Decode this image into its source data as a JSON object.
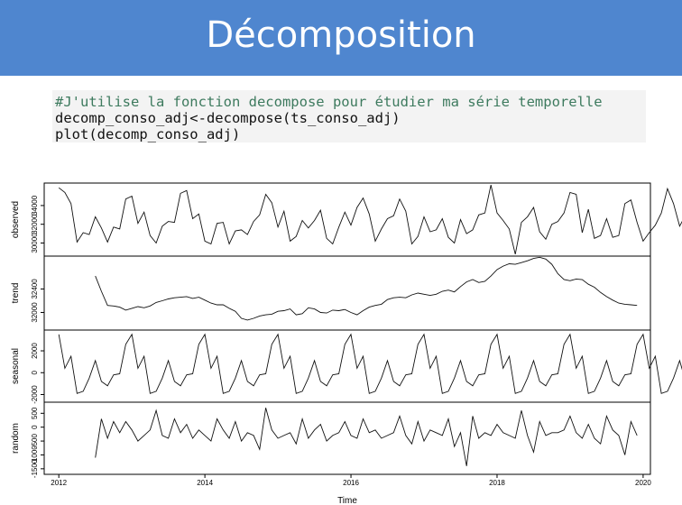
{
  "header": {
    "title": "Décomposition"
  },
  "code": {
    "lines": [
      "#J'utilise la fonction decompose pour étudier ma série temporelle",
      "decomp_conso_adj<-decompose(ts_conso_adj)",
      "plot(decomp_conso_adj)"
    ]
  },
  "chart_data": {
    "type": "line",
    "x_axis": {
      "ticks": [
        "2012",
        "2014",
        "2016",
        "2018",
        "2020"
      ],
      "range": [
        2011.8,
        2020.1
      ],
      "label": "Time"
    },
    "time_start": 2012.0,
    "time_step": 0.0833333,
    "panels": [
      {
        "name": "observed",
        "ylim": [
          28600,
          36400
        ],
        "ticks": [
          30000,
          32000,
          34000
        ],
        "tick_labels": [
          "30000",
          "32000",
          "34000"
        ],
        "values": [
          35900,
          35400,
          34200,
          30100,
          31100,
          30900,
          32800,
          31600,
          30100,
          31700,
          31500,
          34700,
          35000,
          32100,
          33300,
          30800,
          30000,
          31800,
          32300,
          32200,
          35300,
          35600,
          32600,
          33100,
          30200,
          29900,
          32100,
          32200,
          29900,
          31300,
          31400,
          30900,
          32300,
          33000,
          35200,
          34300,
          31700,
          33400,
          30200,
          30700,
          32400,
          31600,
          32400,
          33500,
          30500,
          29900,
          31700,
          33300,
          31900,
          33800,
          34800,
          33100,
          30200,
          31500,
          32600,
          32900,
          34700,
          33400,
          29900,
          30700,
          32800,
          31200,
          31400,
          32600,
          30600,
          30000,
          32500,
          31000,
          31400,
          33000,
          33200,
          36200,
          33200,
          32400,
          31500,
          28800,
          32200,
          32800,
          33800,
          31200,
          30400,
          32000,
          32300,
          33200,
          35400,
          35200,
          31100,
          33600,
          30500,
          30800,
          32600,
          30600,
          30800,
          34200,
          34600,
          32200,
          30200,
          31100,
          31900,
          33200,
          35800,
          34200,
          31800,
          33000,
          30200,
          30100,
          31300,
          31800,
          30200,
          30700,
          31700,
          34000,
          31100,
          30700,
          31300,
          33200
        ]
      },
      {
        "name": "trend",
        "ylim": [
          31700,
          32960
        ],
        "ticks": [
          32000,
          32400
        ],
        "tick_labels": [
          "32000",
          "32400"
        ],
        "start_index": 6,
        "values": [
          32620,
          32360,
          32120,
          32110,
          32090,
          32040,
          32070,
          32100,
          32080,
          32110,
          32170,
          32200,
          32230,
          32250,
          32260,
          32270,
          32240,
          32260,
          32210,
          32160,
          32130,
          32130,
          32070,
          32020,
          31900,
          31870,
          31900,
          31940,
          31960,
          31970,
          32020,
          32030,
          32060,
          31960,
          31980,
          32080,
          32060,
          32000,
          31990,
          32040,
          32030,
          32050,
          32000,
          31960,
          32030,
          32090,
          32120,
          32140,
          32220,
          32250,
          32260,
          32250,
          32300,
          32330,
          32310,
          32290,
          32310,
          32360,
          32380,
          32350,
          32440,
          32520,
          32560,
          32510,
          32530,
          32620,
          32730,
          32790,
          32830,
          32820,
          32850,
          32880,
          32920,
          32940,
          32910,
          32820,
          32660,
          32560,
          32540,
          32570,
          32560,
          32480,
          32430,
          32340,
          32270,
          32210,
          32160,
          32140,
          32130,
          32120
        ]
      },
      {
        "name": "seasonal",
        "ylim": [
          -2700,
          3900
        ],
        "ticks": [
          -2000,
          0,
          2000
        ],
        "tick_labels": [
          "-2000",
          "0",
          "2000"
        ],
        "values": [
          3500,
          400,
          1500,
          -1900,
          -1700,
          -500,
          1100,
          -800,
          -1200,
          -200,
          -100,
          2600,
          3500,
          400,
          1500,
          -1900,
          -1700,
          -500,
          1100,
          -800,
          -1200,
          -200,
          -100,
          2600,
          3500,
          400,
          1500,
          -1900,
          -1700,
          -500,
          1100,
          -800,
          -1200,
          -200,
          -100,
          2600,
          3500,
          400,
          1500,
          -1900,
          -1700,
          -500,
          1100,
          -800,
          -1200,
          -200,
          -100,
          2600,
          3500,
          400,
          1500,
          -1900,
          -1700,
          -500,
          1100,
          -800,
          -1200,
          -200,
          -100,
          2600,
          3500,
          400,
          1500,
          -1900,
          -1700,
          -500,
          1100,
          -800,
          -1200,
          -200,
          -100,
          2600,
          3500,
          400,
          1500,
          -1900,
          -1700,
          -500,
          1100,
          -800,
          -1200,
          -200,
          -100,
          2600,
          3500,
          400,
          1500,
          -1900,
          -1700,
          -500,
          1100,
          -800,
          -1200,
          -200,
          -100,
          2600,
          3500,
          400,
          1500,
          -1900,
          -1700,
          -500,
          1100,
          -800,
          -1200,
          -200,
          -100,
          2600
        ]
      },
      {
        "name": "random",
        "ylim": [
          -1700,
          900
        ],
        "ticks": [
          -1500,
          -1000,
          -500,
          0,
          500
        ],
        "tick_labels": [
          "-1500",
          "-1000",
          "-500",
          "0",
          "500"
        ],
        "start_index": 6,
        "values": [
          -1100,
          300,
          -400,
          200,
          -200,
          200,
          -100,
          -500,
          -300,
          -100,
          600,
          -300,
          -400,
          300,
          -200,
          100,
          -400,
          -100,
          -300,
          -500,
          300,
          -100,
          -400,
          200,
          -500,
          -200,
          -300,
          -800,
          700,
          -100,
          -400,
          -300,
          -200,
          -600,
          300,
          -400,
          -100,
          100,
          -500,
          -300,
          -200,
          200,
          -300,
          -400,
          300,
          -200,
          -100,
          -400,
          -300,
          -200,
          400,
          -300,
          -600,
          200,
          -500,
          -100,
          -200,
          -300,
          300,
          -700,
          -200,
          -1400,
          400,
          -400,
          -200,
          -300,
          100,
          -200,
          -300,
          -400,
          600,
          -300,
          -900,
          200,
          -300,
          -200,
          -200,
          -100,
          400,
          -200,
          -400,
          100,
          -400,
          -600,
          400,
          -100,
          -300,
          -1000,
          200,
          -300
        ]
      }
    ]
  }
}
